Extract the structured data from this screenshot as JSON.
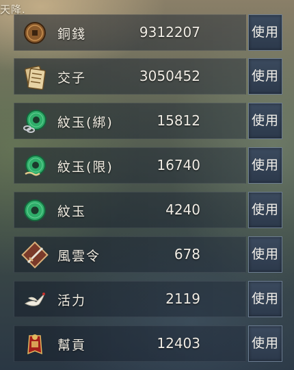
{
  "top_text": "天降.",
  "items": [
    {
      "name": "銅錢",
      "count": "9312207",
      "icon": "copper-coin-icon",
      "button": "使用"
    },
    {
      "name": "交子",
      "count": "3050452",
      "icon": "paper-money-icon",
      "button": "使用"
    },
    {
      "name": "紋玉(綁)",
      "count": "15812",
      "icon": "bound-jade-icon",
      "button": "使用"
    },
    {
      "name": "紋玉(限)",
      "count": "16740",
      "icon": "limited-jade-icon",
      "button": "使用"
    },
    {
      "name": "紋玉",
      "count": "4240",
      "icon": "jade-icon",
      "button": "使用"
    },
    {
      "name": "風雲令",
      "count": "678",
      "icon": "token-sword-icon",
      "button": "使用"
    },
    {
      "name": "活力",
      "count": "2119",
      "icon": "crane-icon",
      "button": "使用"
    },
    {
      "name": "幫貢",
      "count": "12403",
      "icon": "guild-badge-icon",
      "button": "使用"
    }
  ],
  "colors": {
    "jade": "#2fae6a",
    "gold": "#c9a45a",
    "panel": "#1c2636",
    "button_border": "#6d7e93"
  }
}
